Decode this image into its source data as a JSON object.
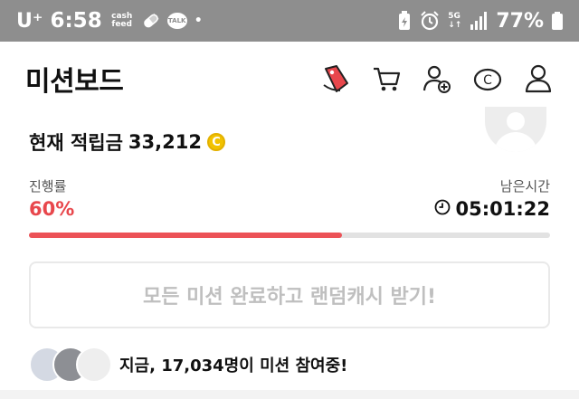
{
  "status_bar": {
    "carrier": "U⁺",
    "time": "6:58",
    "cashfeed_line1": "cash",
    "cashfeed_line2": "feed",
    "talk_label": "TALK",
    "dot": "•",
    "network": "5G",
    "battery_percent": "77%",
    "icons": [
      "pill-icon",
      "talk-icon",
      "battery-saver-icon",
      "alarm-icon",
      "signal-icon",
      "battery-icon"
    ]
  },
  "header": {
    "title": "미션보드",
    "icons": [
      "mission-tag-icon",
      "cart-icon",
      "add-friend-icon",
      "cash-coin-icon",
      "profile-icon"
    ]
  },
  "balance": {
    "label": "현재 적립금",
    "amount": "33,212",
    "coin_symbol": "C"
  },
  "progress": {
    "label": "진행률",
    "value_text": "60%",
    "fraction": 0.6
  },
  "remaining": {
    "label": "남은시간",
    "time": "05:01:22"
  },
  "claim_button": {
    "label": "모든 미션 완료하고 랜덤캐시 받기!"
  },
  "participants": {
    "text": "지금, 17,034명이 미션 참여중!"
  },
  "colors": {
    "accent": "#ec5257",
    "status_bar_bg": "#8e8e8e",
    "coin": "#f2c200"
  }
}
